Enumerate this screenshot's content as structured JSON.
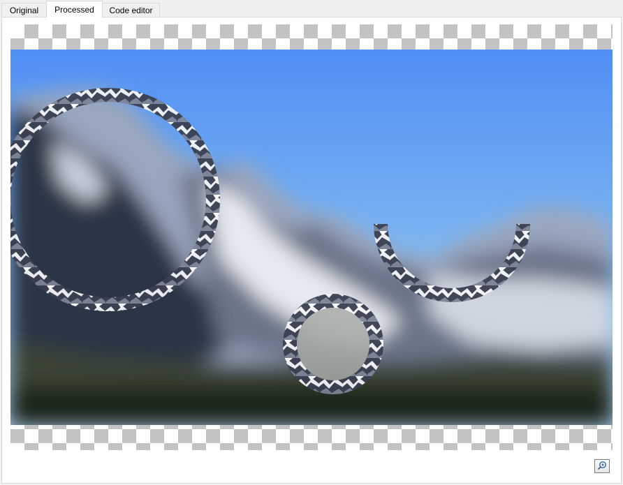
{
  "tabs": [
    {
      "label": "Original",
      "active": false
    },
    {
      "label": "Processed",
      "active": true
    },
    {
      "label": "Code editor",
      "active": false
    }
  ],
  "canvas": {
    "background": "checkerboard-transparency",
    "checker_colors": [
      "#c3c3c3",
      "#ffffff"
    ]
  },
  "preview": {
    "subject": "blurred mountain landscape with sharp ring-shaped regions",
    "sky_colors": [
      "#4f8ff5",
      "#7eb6ef"
    ]
  },
  "zoom_button": {
    "icon": "zoom-icon"
  }
}
